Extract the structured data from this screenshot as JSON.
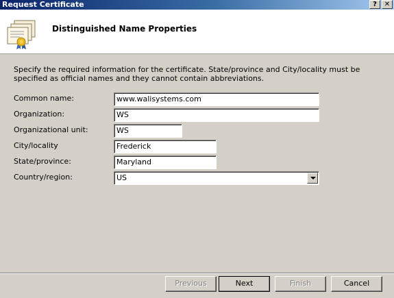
{
  "window": {
    "title": "Request Certificate",
    "help_label": "?",
    "close_label": "✕"
  },
  "header": {
    "heading": "Distinguished Name Properties",
    "icon": "certificate-icon"
  },
  "instructions": "Specify the required information for the certificate. State/province and City/locality must be specified as official names and they cannot contain abbreviations.",
  "fields": {
    "common_name": {
      "label": "Common name:",
      "value": "www.walisystems.com"
    },
    "organization": {
      "label": "Organization:",
      "value": "WS"
    },
    "organizational_unit": {
      "label": "Organizational unit:",
      "value": "WS"
    },
    "city": {
      "label": "City/locality",
      "value": "Frederick"
    },
    "state": {
      "label": "State/province:",
      "value": "Maryland"
    },
    "country": {
      "label": "Country/region:",
      "value": "US"
    }
  },
  "buttons": {
    "previous": "Previous",
    "next": "Next",
    "finish": "Finish",
    "cancel": "Cancel"
  }
}
